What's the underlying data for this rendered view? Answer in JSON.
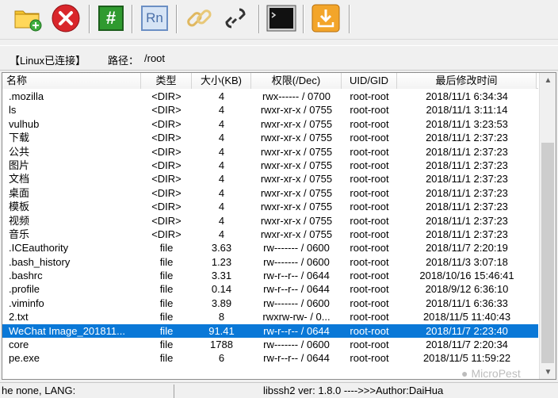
{
  "toolbar": {
    "buttons": [
      {
        "name": "new-folder",
        "icon": "folder-plus-icon"
      },
      {
        "name": "delete",
        "icon": "red-x-icon"
      },
      {
        "name": "hash",
        "icon": "green-hash-icon",
        "glyph": "#"
      },
      {
        "name": "rename",
        "icon": "rn-icon",
        "glyph": "Rn"
      },
      {
        "name": "link",
        "icon": "chain-link-icon"
      },
      {
        "name": "unlink",
        "icon": "broken-link-icon"
      },
      {
        "name": "terminal",
        "icon": "terminal-icon"
      },
      {
        "name": "download",
        "icon": "download-icon"
      }
    ]
  },
  "pathbar": {
    "connection": "【Linux已连接】",
    "path_label": "路径：",
    "path_value": "/root"
  },
  "table": {
    "columns": [
      "名称",
      "类型",
      "大小(KB)",
      "权限(/Dec)",
      "UID/GID",
      "最后修改时间"
    ],
    "rows": [
      {
        "name": ".mozilla",
        "type": "<DIR>",
        "size": "4",
        "perm": "rwx------ / 0700",
        "uid": "root-root",
        "time": "2018/11/1 6:34:34"
      },
      {
        "name": "ls",
        "type": "<DIR>",
        "size": "4",
        "perm": "rwxr-xr-x / 0755",
        "uid": "root-root",
        "time": "2018/11/1 3:11:14"
      },
      {
        "name": "vulhub",
        "type": "<DIR>",
        "size": "4",
        "perm": "rwxr-xr-x / 0755",
        "uid": "root-root",
        "time": "2018/11/1 3:23:53"
      },
      {
        "name": "下载",
        "type": "<DIR>",
        "size": "4",
        "perm": "rwxr-xr-x / 0755",
        "uid": "root-root",
        "time": "2018/11/1 2:37:23"
      },
      {
        "name": "公共",
        "type": "<DIR>",
        "size": "4",
        "perm": "rwxr-xr-x / 0755",
        "uid": "root-root",
        "time": "2018/11/1 2:37:23"
      },
      {
        "name": "图片",
        "type": "<DIR>",
        "size": "4",
        "perm": "rwxr-xr-x / 0755",
        "uid": "root-root",
        "time": "2018/11/1 2:37:23"
      },
      {
        "name": "文档",
        "type": "<DIR>",
        "size": "4",
        "perm": "rwxr-xr-x / 0755",
        "uid": "root-root",
        "time": "2018/11/1 2:37:23"
      },
      {
        "name": "桌面",
        "type": "<DIR>",
        "size": "4",
        "perm": "rwxr-xr-x / 0755",
        "uid": "root-root",
        "time": "2018/11/1 2:37:23"
      },
      {
        "name": "模板",
        "type": "<DIR>",
        "size": "4",
        "perm": "rwxr-xr-x / 0755",
        "uid": "root-root",
        "time": "2018/11/1 2:37:23"
      },
      {
        "name": "视频",
        "type": "<DIR>",
        "size": "4",
        "perm": "rwxr-xr-x / 0755",
        "uid": "root-root",
        "time": "2018/11/1 2:37:23"
      },
      {
        "name": "音乐",
        "type": "<DIR>",
        "size": "4",
        "perm": "rwxr-xr-x / 0755",
        "uid": "root-root",
        "time": "2018/11/1 2:37:23"
      },
      {
        "name": ".ICEauthority",
        "type": "file",
        "size": "3.63",
        "perm": "rw------- / 0600",
        "uid": "root-root",
        "time": "2018/11/7 2:20:19"
      },
      {
        "name": ".bash_history",
        "type": "file",
        "size": "1.23",
        "perm": "rw------- / 0600",
        "uid": "root-root",
        "time": "2018/11/3 3:07:18"
      },
      {
        "name": ".bashrc",
        "type": "file",
        "size": "3.31",
        "perm": "rw-r--r-- / 0644",
        "uid": "root-root",
        "time": "2018/10/16 15:46:41"
      },
      {
        "name": ".profile",
        "type": "file",
        "size": "0.14",
        "perm": "rw-r--r-- / 0644",
        "uid": "root-root",
        "time": "2018/9/12 6:36:10"
      },
      {
        "name": ".viminfo",
        "type": "file",
        "size": "3.89",
        "perm": "rw------- / 0600",
        "uid": "root-root",
        "time": "2018/11/1 6:36:33"
      },
      {
        "name": "2.txt",
        "type": "file",
        "size": "8",
        "perm": "rwxrw-rw- / 0...",
        "uid": "root-root",
        "time": "2018/11/5 11:40:43"
      },
      {
        "name": "WeChat Image_201811...",
        "type": "file",
        "size": "91.41",
        "perm": "rw-r--r-- / 0644",
        "uid": "root-root",
        "time": "2018/11/7 2:23:40",
        "selected": true
      },
      {
        "name": "core",
        "type": "file",
        "size": "1788",
        "perm": "rw------- / 0600",
        "uid": "root-root",
        "time": "2018/11/7 2:20:34"
      },
      {
        "name": "pe.exe",
        "type": "file",
        "size": "6",
        "perm": "rw-r--r-- / 0644",
        "uid": "root-root",
        "time": "2018/11/5 11:59:22"
      }
    ]
  },
  "statusbar": {
    "left": "he none, LANG:",
    "right": "libssh2 ver: 1.8.0 ---->>>Author:DaiHua"
  },
  "watermark": "MicroPest",
  "colors": {
    "selected_row": "#0a78d7",
    "background": "#f0f0f0"
  }
}
